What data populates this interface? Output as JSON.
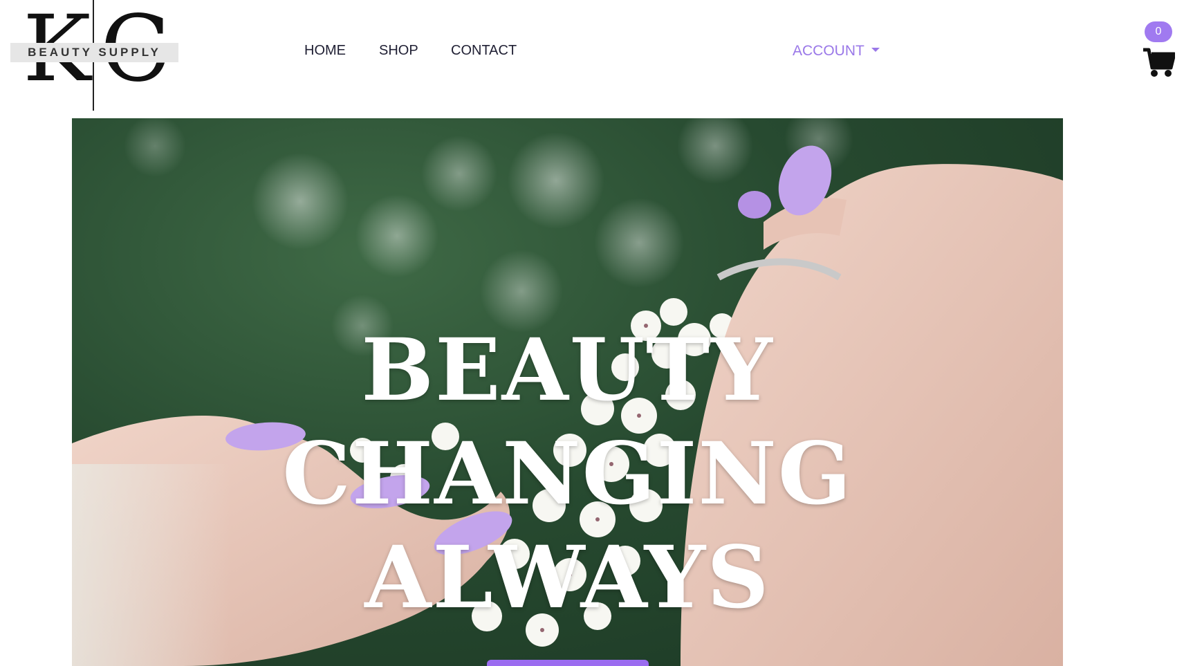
{
  "header": {
    "logo": {
      "letter_left": "K",
      "letter_right": "C",
      "tagline": "BEAUTY SUPPLY"
    },
    "nav": [
      {
        "label": "HOME"
      },
      {
        "label": "SHOP"
      },
      {
        "label": "CONTACT"
      }
    ],
    "account": {
      "label": "ACCOUNT",
      "color": "#9a78e8"
    },
    "cart": {
      "count": "0",
      "badge_color": "#a07af0",
      "icon": "cart-icon"
    }
  },
  "hero": {
    "title_lines": [
      "BEAUTY",
      "CHANGING",
      "ALWAYS"
    ],
    "accent_color": "#9b6cf0",
    "nail_color": "#c3a4ec"
  }
}
